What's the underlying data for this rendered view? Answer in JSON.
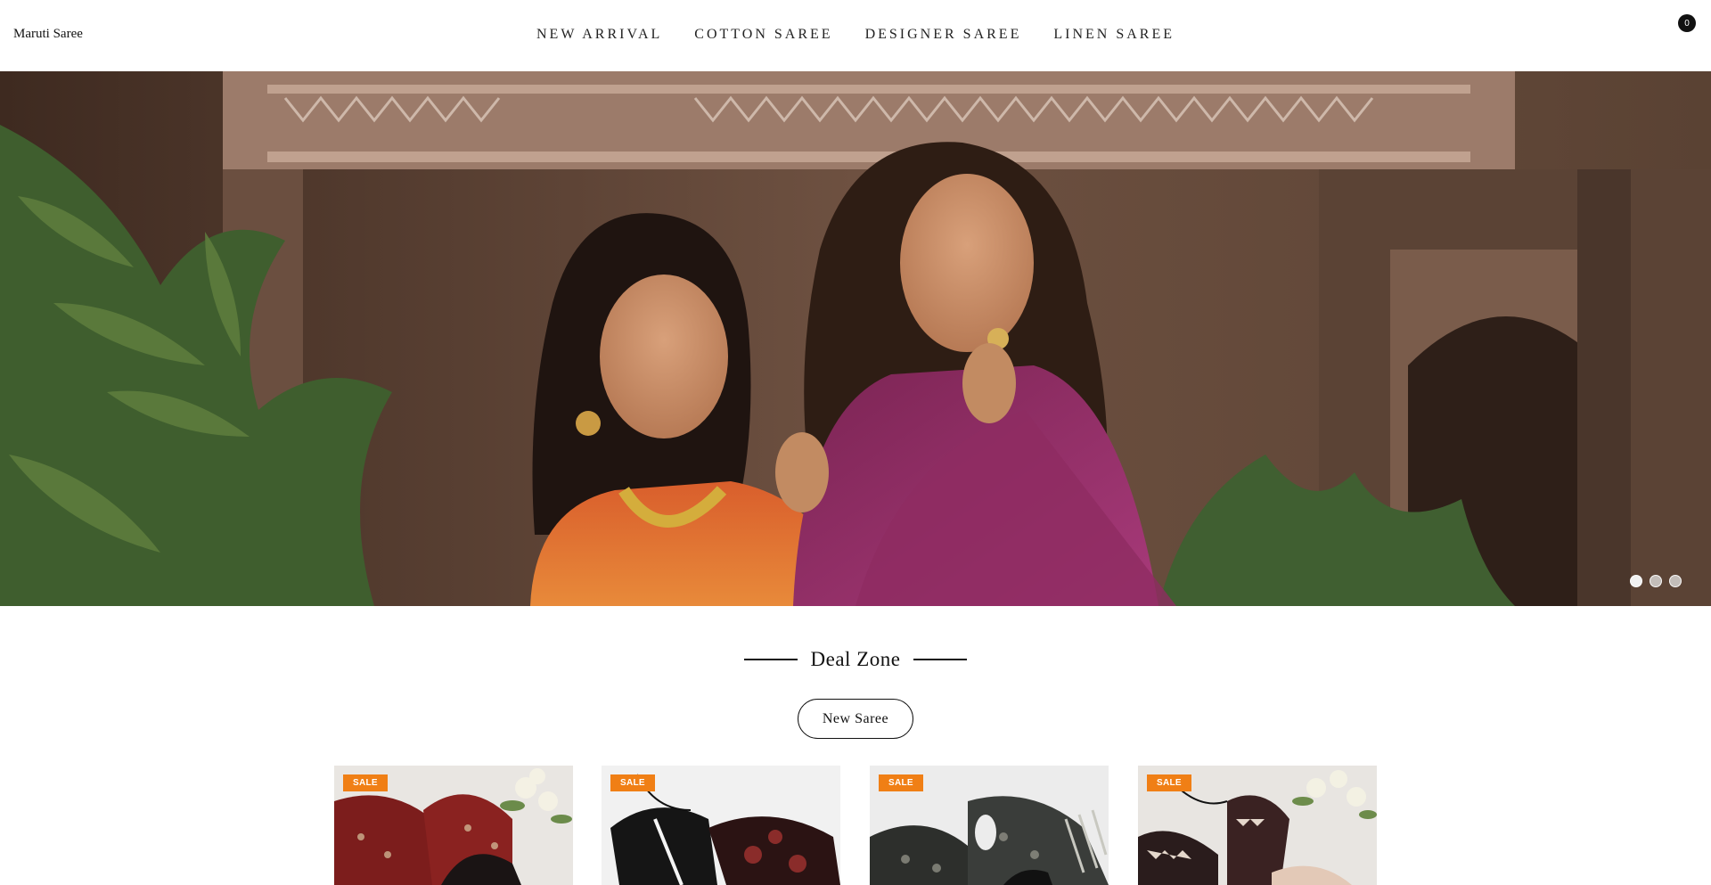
{
  "header": {
    "brand": "Maruti Saree",
    "nav": [
      {
        "label": "NEW ARRIVAL"
      },
      {
        "label": "COTTON SAREE"
      },
      {
        "label": "DESIGNER SAREE"
      },
      {
        "label": "LINEN SAREE"
      }
    ],
    "cart_count": "0"
  },
  "hero": {
    "slide_count": 3,
    "active_slide": 1
  },
  "deal_zone": {
    "title": "Deal Zone",
    "tab_label": "New Saree"
  },
  "products": [
    {
      "badge": "SALE"
    },
    {
      "badge": "SALE"
    },
    {
      "badge": "SALE"
    },
    {
      "badge": "SALE"
    }
  ],
  "colors": {
    "sale_badge": "#f07f15",
    "text": "#111111",
    "background": "#ffffff"
  }
}
